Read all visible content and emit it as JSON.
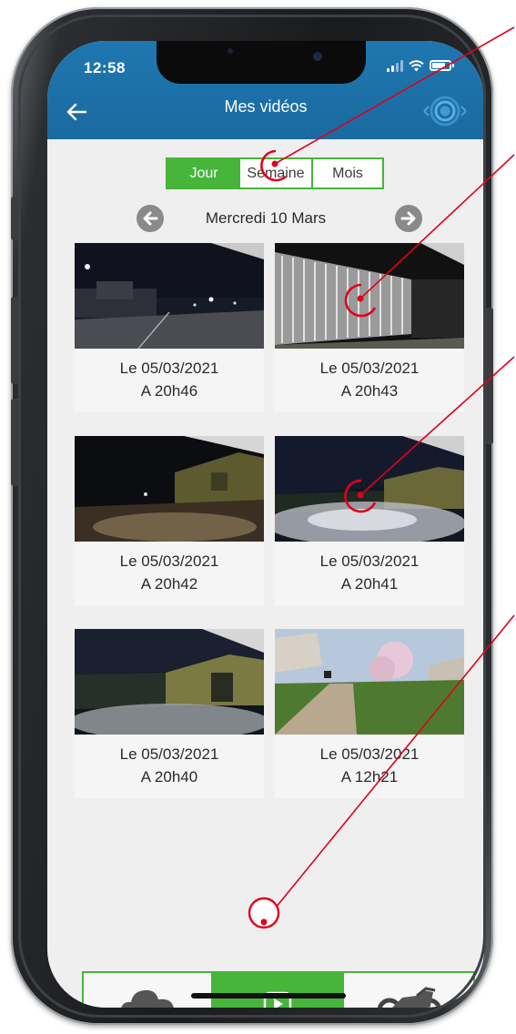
{
  "status_bar": {
    "time": "12:58"
  },
  "header": {
    "title": "Mes vidéos",
    "back_icon": "arrow-left-icon",
    "logo_icon": "eye-radar-logo-icon"
  },
  "tabs": [
    {
      "label": "Jour",
      "active": true
    },
    {
      "label": "Semaine",
      "active": false
    },
    {
      "label": "Mois",
      "active": false
    }
  ],
  "date_nav": {
    "label": "Mercredi 10 Mars",
    "prev_icon": "arrow-left-circle-icon",
    "next_icon": "arrow-right-circle-icon"
  },
  "videos": [
    {
      "date": "Le 05/03/2021",
      "time": "A 20h46",
      "scene": "night-street"
    },
    {
      "date": "Le 05/03/2021",
      "time": "A 20h43",
      "scene": "night-gate"
    },
    {
      "date": "Le 05/03/2021",
      "time": "A 20h42",
      "scene": "night-building"
    },
    {
      "date": "Le 05/03/2021",
      "time": "A 20h41",
      "scene": "night-headlights"
    },
    {
      "date": "Le 05/03/2021",
      "time": "A 20h40",
      "scene": "night-yard"
    },
    {
      "date": "Le 05/03/2021",
      "time": "A 12h21",
      "scene": "day-garden"
    }
  ],
  "bottom_nav": [
    {
      "icon": "cloud-icon",
      "active": false
    },
    {
      "icon": "videos-icon",
      "active": true
    },
    {
      "icon": "motorcycle-icon",
      "active": false
    }
  ],
  "colors": {
    "header_blue": "#1f77b0",
    "accent_green": "#46b53a",
    "background": "#efefef",
    "annotation_red": "#e0001a"
  }
}
